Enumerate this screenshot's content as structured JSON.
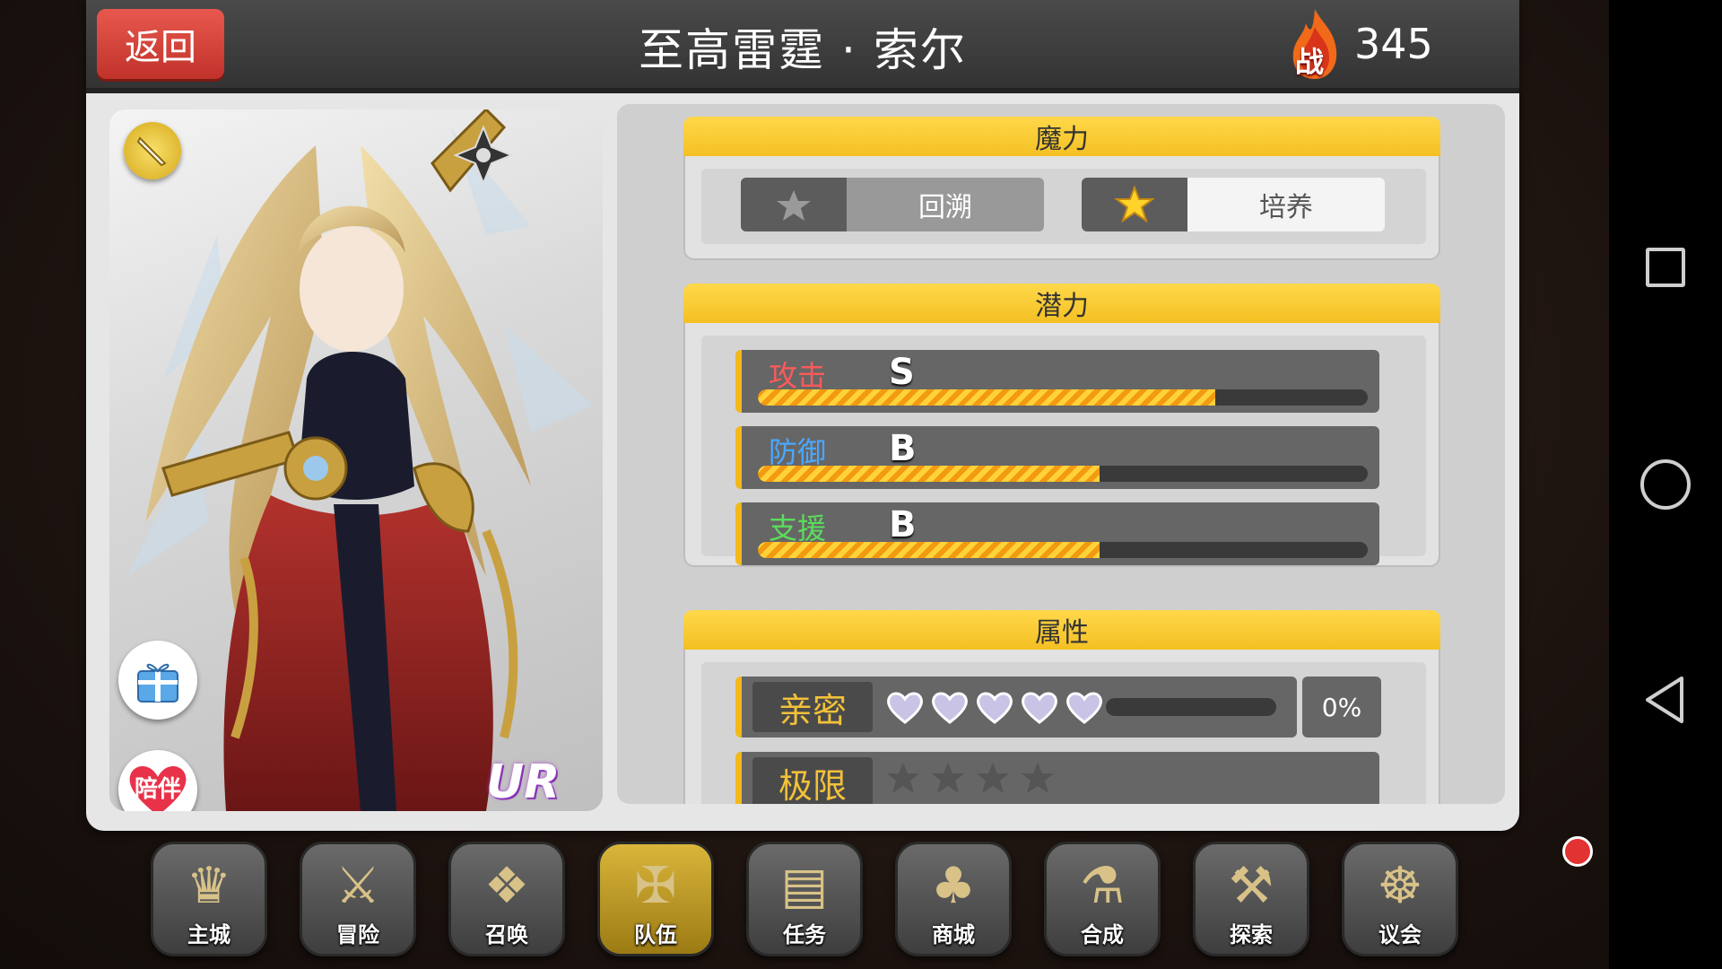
{
  "header": {
    "back_label": "返回",
    "title": "至高雷霆 · 索尔",
    "power_badge": "战",
    "power_value": "345"
  },
  "card": {
    "rarity": "UR",
    "companion_label": "陪伴"
  },
  "magic": {
    "title": "魔力",
    "rewind_label": "回溯",
    "train_label": "培养"
  },
  "potential": {
    "title": "潜力",
    "stats": [
      {
        "name": "攻击",
        "grade": "S",
        "color": "#ff5a5a",
        "progress": 0.75
      },
      {
        "name": "防御",
        "grade": "B",
        "color": "#4aa8ff",
        "progress": 0.56
      },
      {
        "name": "支援",
        "grade": "B",
        "color": "#5cdc5c",
        "progress": 0.56
      }
    ]
  },
  "attributes": {
    "title": "属性",
    "intimacy_label": "亲密",
    "intimacy_hearts": 5,
    "intimacy_pct": "0%",
    "limit_label": "极限",
    "limit_stars": 4
  },
  "menu": [
    {
      "label": "主城",
      "icon": "crown-icon"
    },
    {
      "label": "冒险",
      "icon": "crossed-weapons-icon"
    },
    {
      "label": "召唤",
      "icon": "summon-card-icon"
    },
    {
      "label": "队伍",
      "icon": "winged-emblem-icon"
    },
    {
      "label": "任务",
      "icon": "book-icon"
    },
    {
      "label": "商城",
      "icon": "shop-tree-icon"
    },
    {
      "label": "合成",
      "icon": "potion-icon"
    },
    {
      "label": "探索",
      "icon": "shovel-icon"
    },
    {
      "label": "议会",
      "icon": "council-crest-icon"
    }
  ]
}
